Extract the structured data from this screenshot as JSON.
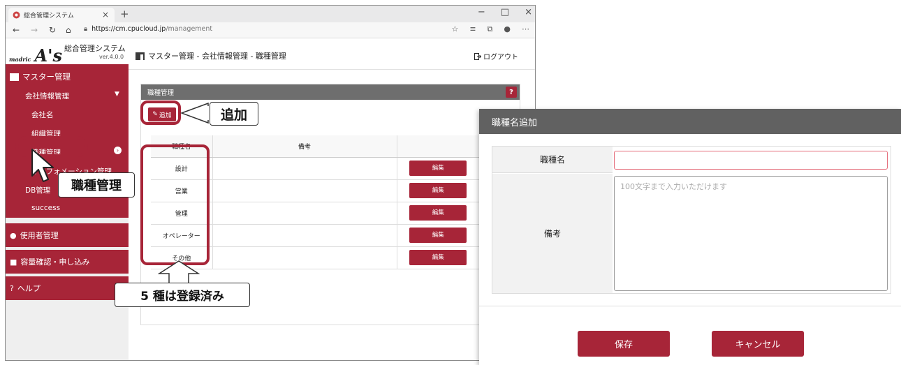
{
  "browser": {
    "tab_title": "総合管理システム",
    "tab_close": "×",
    "new_tab": "+",
    "url_host": "https://cm.cpucloud.jp",
    "url_path": "/management",
    "controls": [
      "−",
      "□",
      "×"
    ]
  },
  "app": {
    "logo_small": "madric",
    "logo_big": "A's",
    "system_title": "総合管理システム",
    "version": "ver.4.0.0",
    "breadcrumb": "マスター管理 - 会社情報管理 - 職種管理",
    "logout": "ログアウト"
  },
  "sidebar": {
    "master": "マスター管理",
    "company_info": "会社情報管理",
    "items": [
      "会社名",
      "組織管理",
      "職種管理",
      "インフォメーション管理"
    ],
    "db": "DB管理",
    "success": "success",
    "users": "使用者管理",
    "capacity": "容量確認・申し込み",
    "help": "ヘルプ"
  },
  "panel": {
    "title": "職種管理",
    "help": "?",
    "add_label": "追加",
    "columns": [
      "職種名",
      "備考",
      ""
    ],
    "rows": [
      {
        "name": "設計",
        "note": ""
      },
      {
        "name": "営業",
        "note": ""
      },
      {
        "name": "管理",
        "note": ""
      },
      {
        "name": "オペレーター",
        "note": ""
      },
      {
        "name": "その他",
        "note": ""
      }
    ],
    "edit_label": "編集"
  },
  "annotations": {
    "add": "追加",
    "job_mgmt": "職種管理",
    "registered": "5 種は登録済み"
  },
  "dialog": {
    "title": "職種名追加",
    "name_label": "職種名",
    "name_value": "",
    "note_label": "備考",
    "note_placeholder": "100文字まで入力いただけます",
    "save": "保存",
    "cancel": "キャンセル"
  },
  "colors": {
    "accent": "#a72538",
    "panel_header": "#6e6e6e",
    "dialog_header": "#616161"
  }
}
